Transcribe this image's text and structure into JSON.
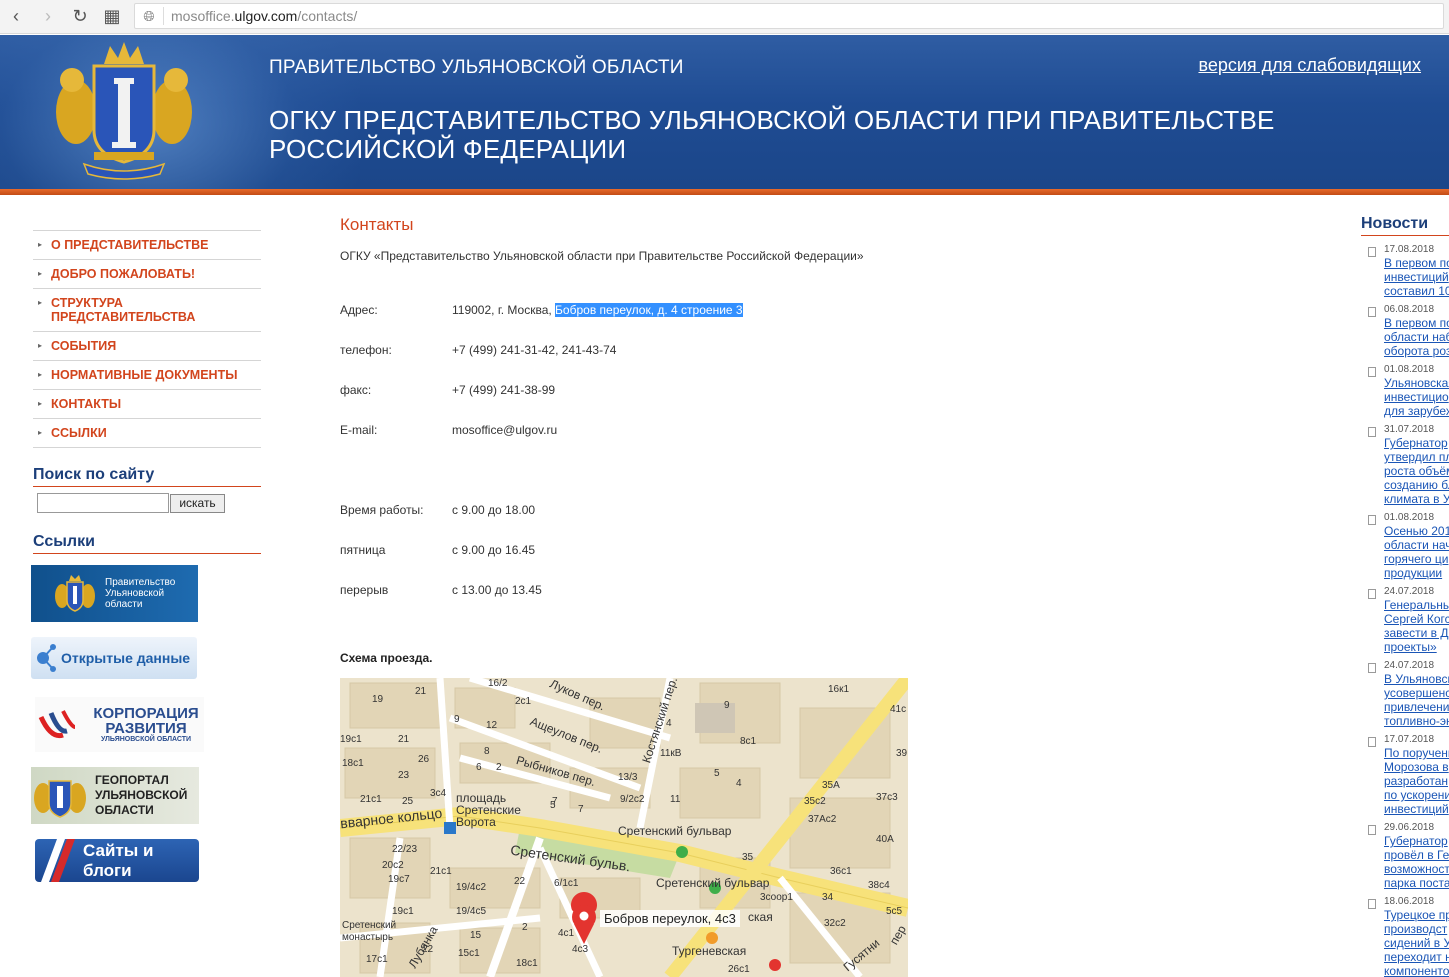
{
  "browser": {
    "url_prefix": "mosoffice.",
    "url_domain": "ulgov.com",
    "url_path": "/contacts/"
  },
  "header": {
    "gov_title": "ПРАВИТЕЛЬСТВО УЛЬЯНОВСКОЙ ОБЛАСТИ",
    "org_title": "ОГКУ ПРЕДСТАВИТЕЛЬСТВО УЛЬЯНОВСКОЙ ОБЛАСТИ ПРИ ПРАВИТЕЛЬСТВЕ РОССИЙСКОЙ ФЕДЕРАЦИИ",
    "vision_link": "версия для слабовидящих",
    "colors": {
      "header_blue": "#1f4c93",
      "stripe_orange": "#d2451d"
    }
  },
  "menu": [
    {
      "label": "О ПРЕДСТАВИТЕЛЬСТВЕ"
    },
    {
      "label": "ДОБРО ПОЖАЛОВАТЬ!"
    },
    {
      "label": "СТРУКТУРА ПРЕДСТАВИТЕЛЬСТВА"
    },
    {
      "label": "СОБЫТИЯ"
    },
    {
      "label": "НОРМАТИВНЫЕ ДОКУМЕНТЫ"
    },
    {
      "label": "КОНТАКТЫ"
    },
    {
      "label": "ССЫЛКИ"
    }
  ],
  "search": {
    "heading": "Поиск по сайту",
    "button": "искать",
    "value": ""
  },
  "links": {
    "heading": "Ссылки",
    "banners": [
      {
        "text": "Правительство Ульяновской области"
      },
      {
        "text": "Открытые данные"
      },
      {
        "text_main": "КОРПОРАЦИЯ РАЗВИТИЯ",
        "text_sub": "УЛЬЯНОВСКОЙ ОБЛАСТИ"
      },
      {
        "text": "ГЕОПОРТАЛ УЛЬЯНОВСКОЙ ОБЛАСТИ"
      },
      {
        "text": "Сайты и блоги"
      }
    ]
  },
  "contacts": {
    "title": "Контакты",
    "org_line": "ОГКУ «Представительство Ульяновской области при Правительстве Российской Федерации»",
    "address_label": "Адрес:",
    "address_plain": "119002, г. Москва, ",
    "address_selected": "Бобров переулок, д. 4 строение 3",
    "phone_label": "телефон:",
    "phone": "+7 (499) 241-31-42, 241-43-74",
    "fax_label": "факс:",
    "fax": "+7 (499) 241-38-99",
    "email_label": "E-mail:",
    "email": "mosoffice@ulgov.ru",
    "hours_label": "Время работы:",
    "hours": "с 9.00 до 18.00",
    "friday_label": "пятница",
    "friday": "с 9.00 до 16.45",
    "break_label": "перерыв",
    "break": "с 13.00 до 13.45",
    "scheme_title": "Схема проезда."
  },
  "map": {
    "pin_label": "Бобров переулок, 4с3",
    "streets": [
      "Луков пер.",
      "Ащеулов пер.",
      "Рыбников пер.",
      "Костянский пер.",
      "площадь Сретенские Ворота",
      "Сретенский бульвар",
      "Сретенский бульв.",
      "Сретенский бульвар",
      "вварное кольцо",
      "Тургеневская",
      "Сретенский монастырь",
      "Лубянка",
      "Гусятни",
      "ская",
      "пер"
    ],
    "house_numbers": [
      "16/2",
      "21",
      "19",
      "2с1",
      "9",
      "12",
      "19с1",
      "21",
      "18с1",
      "26",
      "23",
      "8",
      "6",
      "2",
      "11кВ",
      "8с1",
      "9",
      "4",
      "16к1",
      "41с",
      "39",
      "35А",
      "35с2",
      "37с3",
      "37Ас2",
      "40А",
      "36с1",
      "38с4",
      "34",
      "5с5",
      "32с2",
      "3соор1",
      "13/3",
      "9/2с2",
      "11",
      "5",
      "7",
      "21с1",
      "25",
      "3с4",
      "22/23",
      "20с2",
      "19с7",
      "21с1",
      "19/4с2",
      "22",
      "6/1с1",
      "19с1",
      "19/4с5",
      "15",
      "15с1",
      "17с1",
      "22",
      "4с1",
      "4с3",
      "18с1",
      "26с1",
      "2",
      "35",
      "4",
      "5",
      "7"
    ]
  },
  "news": {
    "heading": "Новости",
    "items": [
      {
        "date": "17.08.2018",
        "text": "В первом по\nинвестиций\nсоставил 10"
      },
      {
        "date": "06.08.2018",
        "text": "В первом по\nобласти наб\nоборота роз"
      },
      {
        "date": "01.08.2018",
        "text": "Ульяновская\nинвестицио\nдля зарубеж"
      },
      {
        "date": "31.07.2018",
        "text": "Губернатор\nутвердил пл\nроста объём\nсозданию бл\nклимата в У"
      },
      {
        "date": "01.08.2018",
        "text": "Осенью 201\nобласти нач\nгорячего ци\nпродукции"
      },
      {
        "date": "24.07.2018",
        "text": "Генеральны\nСергей Когс\nзавести в Д\nпроекты»"
      },
      {
        "date": "24.07.2018",
        "text": "В Ульяновск\nусовершенс\nпривлечени\nтопливно-эн"
      },
      {
        "date": "17.07.2018",
        "text": "По поручени\nМорозова в\nразработан\nпо ускорени\nинвестиций"
      },
      {
        "date": "29.06.2018",
        "text": "Губернатор\nпровёл в Ге\nвозможност\nпарка поста"
      },
      {
        "date": "18.06.2018",
        "text": "Турецкое пр\nпроизводст\nсидений в У\nпереходит н\nкомпоненто"
      }
    ]
  }
}
